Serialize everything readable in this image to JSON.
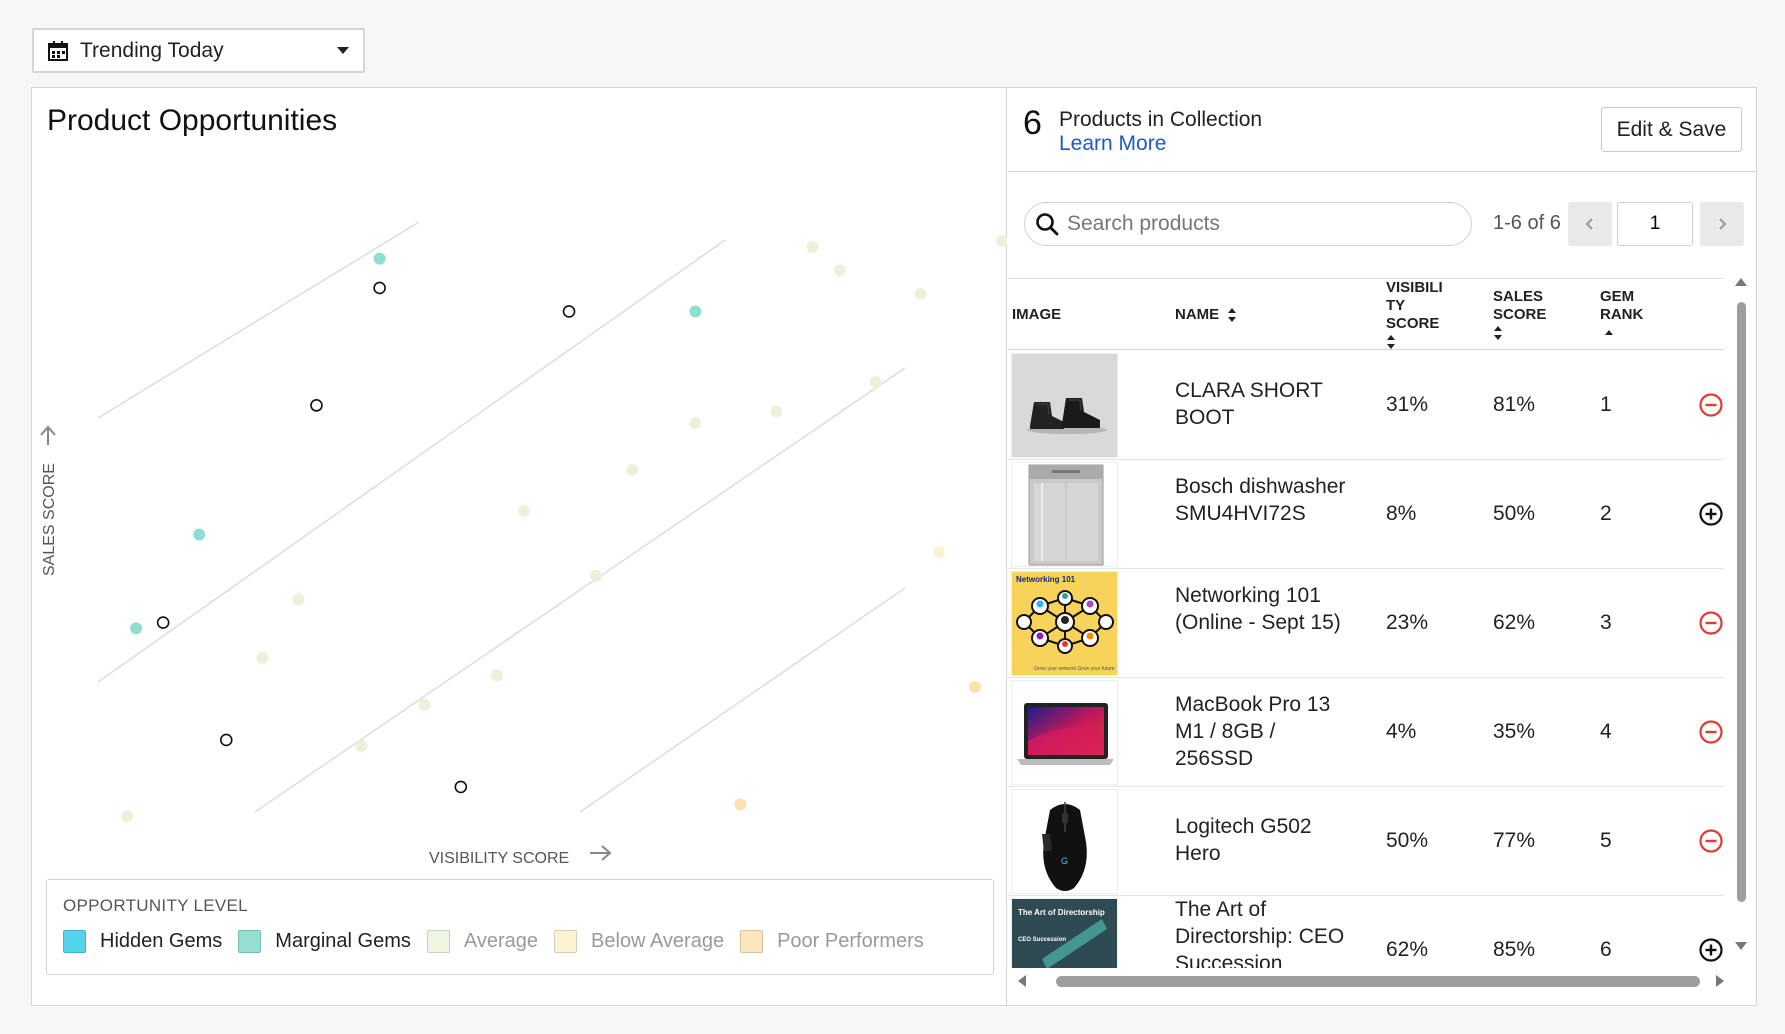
{
  "filter": {
    "selected": "Trending Today"
  },
  "chart": {
    "title": "Product Opportunities",
    "xlabel": "VISIBILITY SCORE",
    "ylabel": "SALES SCORE"
  },
  "chart_data": {
    "type": "scatter",
    "title": "Product Opportunities",
    "xlabel": "VISIBILITY SCORE",
    "ylabel": "SALES SCORE",
    "xlim": [
      0,
      100
    ],
    "ylim": [
      0,
      100
    ],
    "grid": false,
    "series": [
      {
        "name": "Hidden Gems",
        "color": "#4fd1e8",
        "points": []
      },
      {
        "name": "Marginal Gems",
        "color": "#8edfd2",
        "points": [
          [
            4,
            34
          ],
          [
            11,
            50
          ],
          [
            31,
            97
          ],
          [
            66,
            88
          ]
        ]
      },
      {
        "name": "Average",
        "color": "#eaf3d9",
        "points": [
          [
            3,
            2
          ],
          [
            18,
            29
          ],
          [
            22,
            39
          ],
          [
            29,
            14
          ],
          [
            36,
            21
          ],
          [
            44,
            26
          ],
          [
            47,
            54
          ],
          [
            55,
            43
          ],
          [
            59,
            61
          ],
          [
            66,
            69
          ],
          [
            75,
            71
          ],
          [
            79,
            99
          ],
          [
            82,
            95
          ],
          [
            86,
            76
          ],
          [
            91,
            91
          ],
          [
            100,
            100
          ]
        ]
      },
      {
        "name": "Below Average",
        "color": "#fbf2cf",
        "points": [
          [
            93,
            47
          ]
        ]
      },
      {
        "name": "Poor Performers",
        "color": "#fae2b0",
        "points": [
          [
            71,
            4
          ],
          [
            97,
            24
          ]
        ]
      },
      {
        "name": "In Collection",
        "outlined": true,
        "points": [
          [
            7,
            35
          ],
          [
            14,
            15
          ],
          [
            24,
            72
          ],
          [
            31,
            92
          ],
          [
            40,
            7
          ],
          [
            52,
            88
          ]
        ]
      }
    ]
  },
  "legend": {
    "title": "OPPORTUNITY LEVEL",
    "items": [
      {
        "label": "Hidden Gems",
        "color": "#52d4ec",
        "muted": false
      },
      {
        "label": "Marginal Gems",
        "color": "#93e0d3",
        "muted": false
      },
      {
        "label": "Average",
        "color": "#eef5e0",
        "muted": true
      },
      {
        "label": "Below Average",
        "color": "#fcf3d5",
        "muted": true
      },
      {
        "label": "Poor Performers",
        "color": "#fbe6bd",
        "muted": true
      }
    ]
  },
  "collection": {
    "count": "6",
    "label": "Products in Collection",
    "learn_more": "Learn More",
    "edit_save": "Edit & Save"
  },
  "search": {
    "placeholder": "Search products"
  },
  "paging": {
    "range": "1-6 of 6",
    "page": "1"
  },
  "table": {
    "headers": {
      "image": "IMAGE",
      "name": "NAME",
      "visibility": [
        "VISIBILI",
        "TY",
        "SCORE"
      ],
      "sales": [
        "SALES",
        "SCORE"
      ],
      "gem": [
        "GEM",
        "RANK"
      ]
    },
    "rows": [
      {
        "name": "CLARA SHORT BOOT",
        "visibility": "31%",
        "sales": "81%",
        "rank": "1",
        "in_collection": true,
        "image": "boots-image"
      },
      {
        "name": "Bosch dishwasher SMU4HVI72S",
        "visibility": "8%",
        "sales": "50%",
        "rank": "2",
        "in_collection": false,
        "image": "dishwasher-image"
      },
      {
        "name": "Networking 101 (Online - Sept 15)",
        "visibility": "23%",
        "sales": "62%",
        "rank": "3",
        "in_collection": true,
        "image": "networking-image"
      },
      {
        "name": "MacBook Pro 13 M1 / 8GB / 256SSD",
        "visibility": "4%",
        "sales": "35%",
        "rank": "4",
        "in_collection": true,
        "image": "laptop-image"
      },
      {
        "name": "Logitech G502 Hero",
        "visibility": "50%",
        "sales": "77%",
        "rank": "5",
        "in_collection": true,
        "image": "mouse-image"
      },
      {
        "name": "The Art of Directorship: CEO Succession",
        "visibility": "62%",
        "sales": "85%",
        "rank": "6",
        "in_collection": false,
        "image": "book-image"
      }
    ],
    "thumb_text": {
      "networking_title": "Networking 101",
      "networking_caption": "Grow your network  Grow your future",
      "book_title": "The Art of Directorship",
      "book_subtitle": "CEO Succession"
    }
  }
}
